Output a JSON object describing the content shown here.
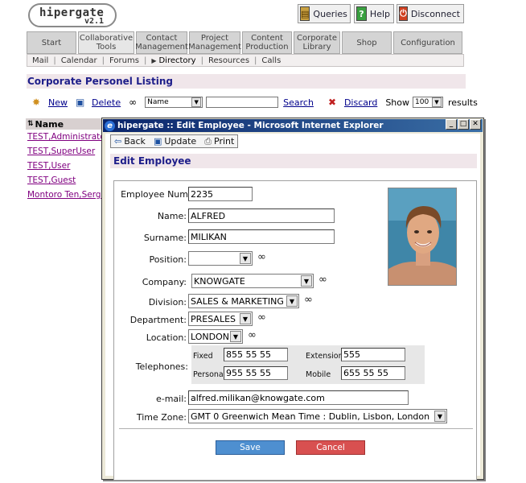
{
  "app": {
    "logo_name": "hipergate",
    "logo_version": "v2.1",
    "top_buttons": [
      {
        "label": "Queries",
        "icon": "queries-icon",
        "color": "#c8a040"
      },
      {
        "label": "Help",
        "icon": "help-icon",
        "color": "#3aa040"
      },
      {
        "label": "Disconnect",
        "icon": "disconnect-icon",
        "color": "#d04020"
      }
    ],
    "tabs": [
      {
        "label": "Start"
      },
      {
        "label": "Collaborative\nTools"
      },
      {
        "label": "Contact\nManagement"
      },
      {
        "label": "Project\nManagement"
      },
      {
        "label": "Content\nProduction"
      },
      {
        "label": "Corporate\nLibrary"
      },
      {
        "label": "Shop"
      },
      {
        "label": "Configuration"
      }
    ],
    "subnav": [
      "Mail",
      "Calendar",
      "Forums",
      "Directory",
      "Resources",
      "Calls"
    ],
    "subnav_active_marker": "▶",
    "section_title": "Corporate Personel Listing",
    "toolbar": {
      "new_label": "New",
      "delete_label": "Delete",
      "field_select": "Name",
      "search_label": "Search",
      "discard_label": "Discard",
      "show_label": "Show",
      "page_size": "100",
      "results_label": "results"
    },
    "list": {
      "header": "Name",
      "items": [
        "TEST,Administrator",
        "TEST,SuperUser",
        "TEST,User",
        "TEST,Guest",
        "Montoro Ten,Sergio"
      ]
    }
  },
  "popup": {
    "window_title": "hipergate :: Edit Employee - Microsoft Internet Explorer",
    "toolbar": {
      "back_label": "Back",
      "update_label": "Update",
      "print_label": "Print"
    },
    "form_title": "Edit Employee",
    "fields": {
      "employee_num": {
        "label": "Employee Num",
        "value": "2235"
      },
      "name": {
        "label": "Name:",
        "value": "ALFRED"
      },
      "surname": {
        "label": "Surname:",
        "value": "MILIKAN"
      },
      "position": {
        "label": "Position:",
        "value": ""
      },
      "company": {
        "label": "Company:",
        "value": "KNOWGATE"
      },
      "division": {
        "label": "Division:",
        "value": "SALES & MARKETING"
      },
      "department": {
        "label": "Department:",
        "value": "PRESALES"
      },
      "location": {
        "label": "Location:",
        "value": "LONDON"
      },
      "telephones": {
        "label": "Telephones:",
        "fixed_label": "Fixed",
        "fixed_value": "855 55 55",
        "extension_label": "Extension",
        "extension_value": "555",
        "personal_label": "Personal",
        "personal_value": "955 55 55",
        "mobile_label": "Mobile",
        "mobile_value": "655 55 55"
      },
      "email": {
        "label": "e-mail:",
        "value": "alfred.milikan@knowgate.com"
      },
      "timezone": {
        "label": "Time Zone:",
        "value": "GMT 0 Greenwich Mean Time : Dublin, Lisbon, London"
      }
    },
    "save_label": "Save",
    "cancel_label": "Cancel"
  }
}
